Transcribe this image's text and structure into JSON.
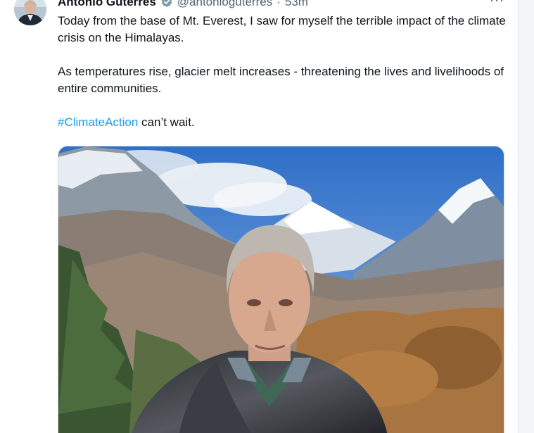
{
  "tweet": {
    "author": {
      "display_name": "António Guterres",
      "handle": "@antonioguterres",
      "verified_icon": "verified-badge-icon",
      "separator": "·",
      "time_ago": "53m"
    },
    "more_label": "···",
    "text_line_1": "Today from the base of Mt. Everest, I saw for myself the terrible impact of the climate crisis on the Himalayas.",
    "text_line_2": "As temperatures rise, glacier melt increases - threatening the lives and livelihoods of entire communities.",
    "hashtag": "#ClimateAction",
    "text_after_hashtag": " can’t wait.",
    "colors": {
      "hashtag": "#1d9bf0",
      "verified": "#829aab",
      "secondary_text": "#536471"
    }
  }
}
